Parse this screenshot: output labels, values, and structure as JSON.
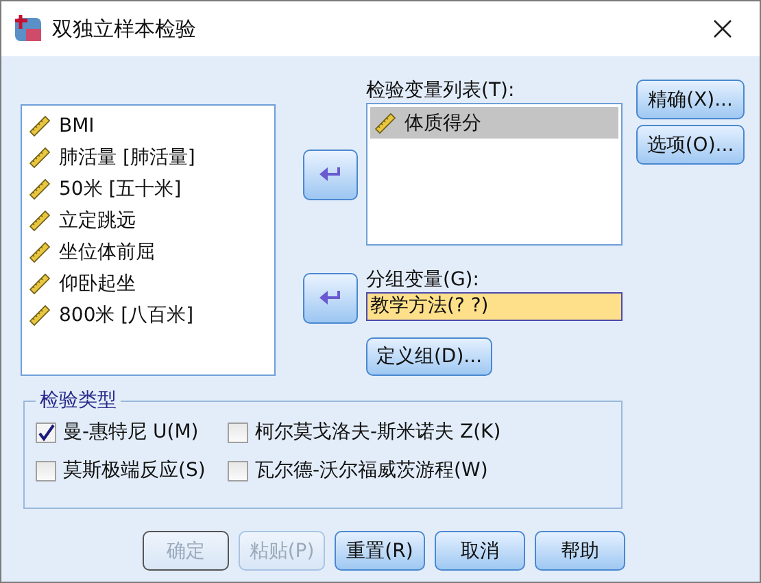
{
  "window": {
    "title": "双独立样本检验"
  },
  "source_list": {
    "items": [
      {
        "label": "BMI"
      },
      {
        "label": "肺活量 [肺活量]"
      },
      {
        "label": "50米 [五十米]"
      },
      {
        "label": "立定跳远"
      },
      {
        "label": "坐位体前屈"
      },
      {
        "label": "仰卧起坐"
      },
      {
        "label": "800米 [八百米]"
      }
    ]
  },
  "test_list": {
    "label": "检验变量列表(T):",
    "items": [
      {
        "label": "体质得分",
        "selected": true
      }
    ]
  },
  "grouping": {
    "label": "分组变量(G):",
    "value": "教学方法(? ?)",
    "define_button": "定义组(D)..."
  },
  "side_buttons": [
    {
      "label": "精确(X)..."
    },
    {
      "label": "选项(O)..."
    }
  ],
  "test_type": {
    "title": "检验类型",
    "options": [
      {
        "label": "曼-惠特尼 U(M)",
        "checked": true
      },
      {
        "label": "柯尔莫戈洛夫-斯米诺夫 Z(K)",
        "checked": false
      },
      {
        "label": "莫斯极端反应(S)",
        "checked": false
      },
      {
        "label": "瓦尔德-沃尔福威茨游程(W)",
        "checked": false
      }
    ]
  },
  "buttons": [
    {
      "label": "确定",
      "disabled": true
    },
    {
      "label": "粘贴(P)",
      "disabled": true
    },
    {
      "label": "重置(R)",
      "disabled": false
    },
    {
      "label": "取消",
      "disabled": false
    },
    {
      "label": "帮助",
      "disabled": false
    }
  ]
}
